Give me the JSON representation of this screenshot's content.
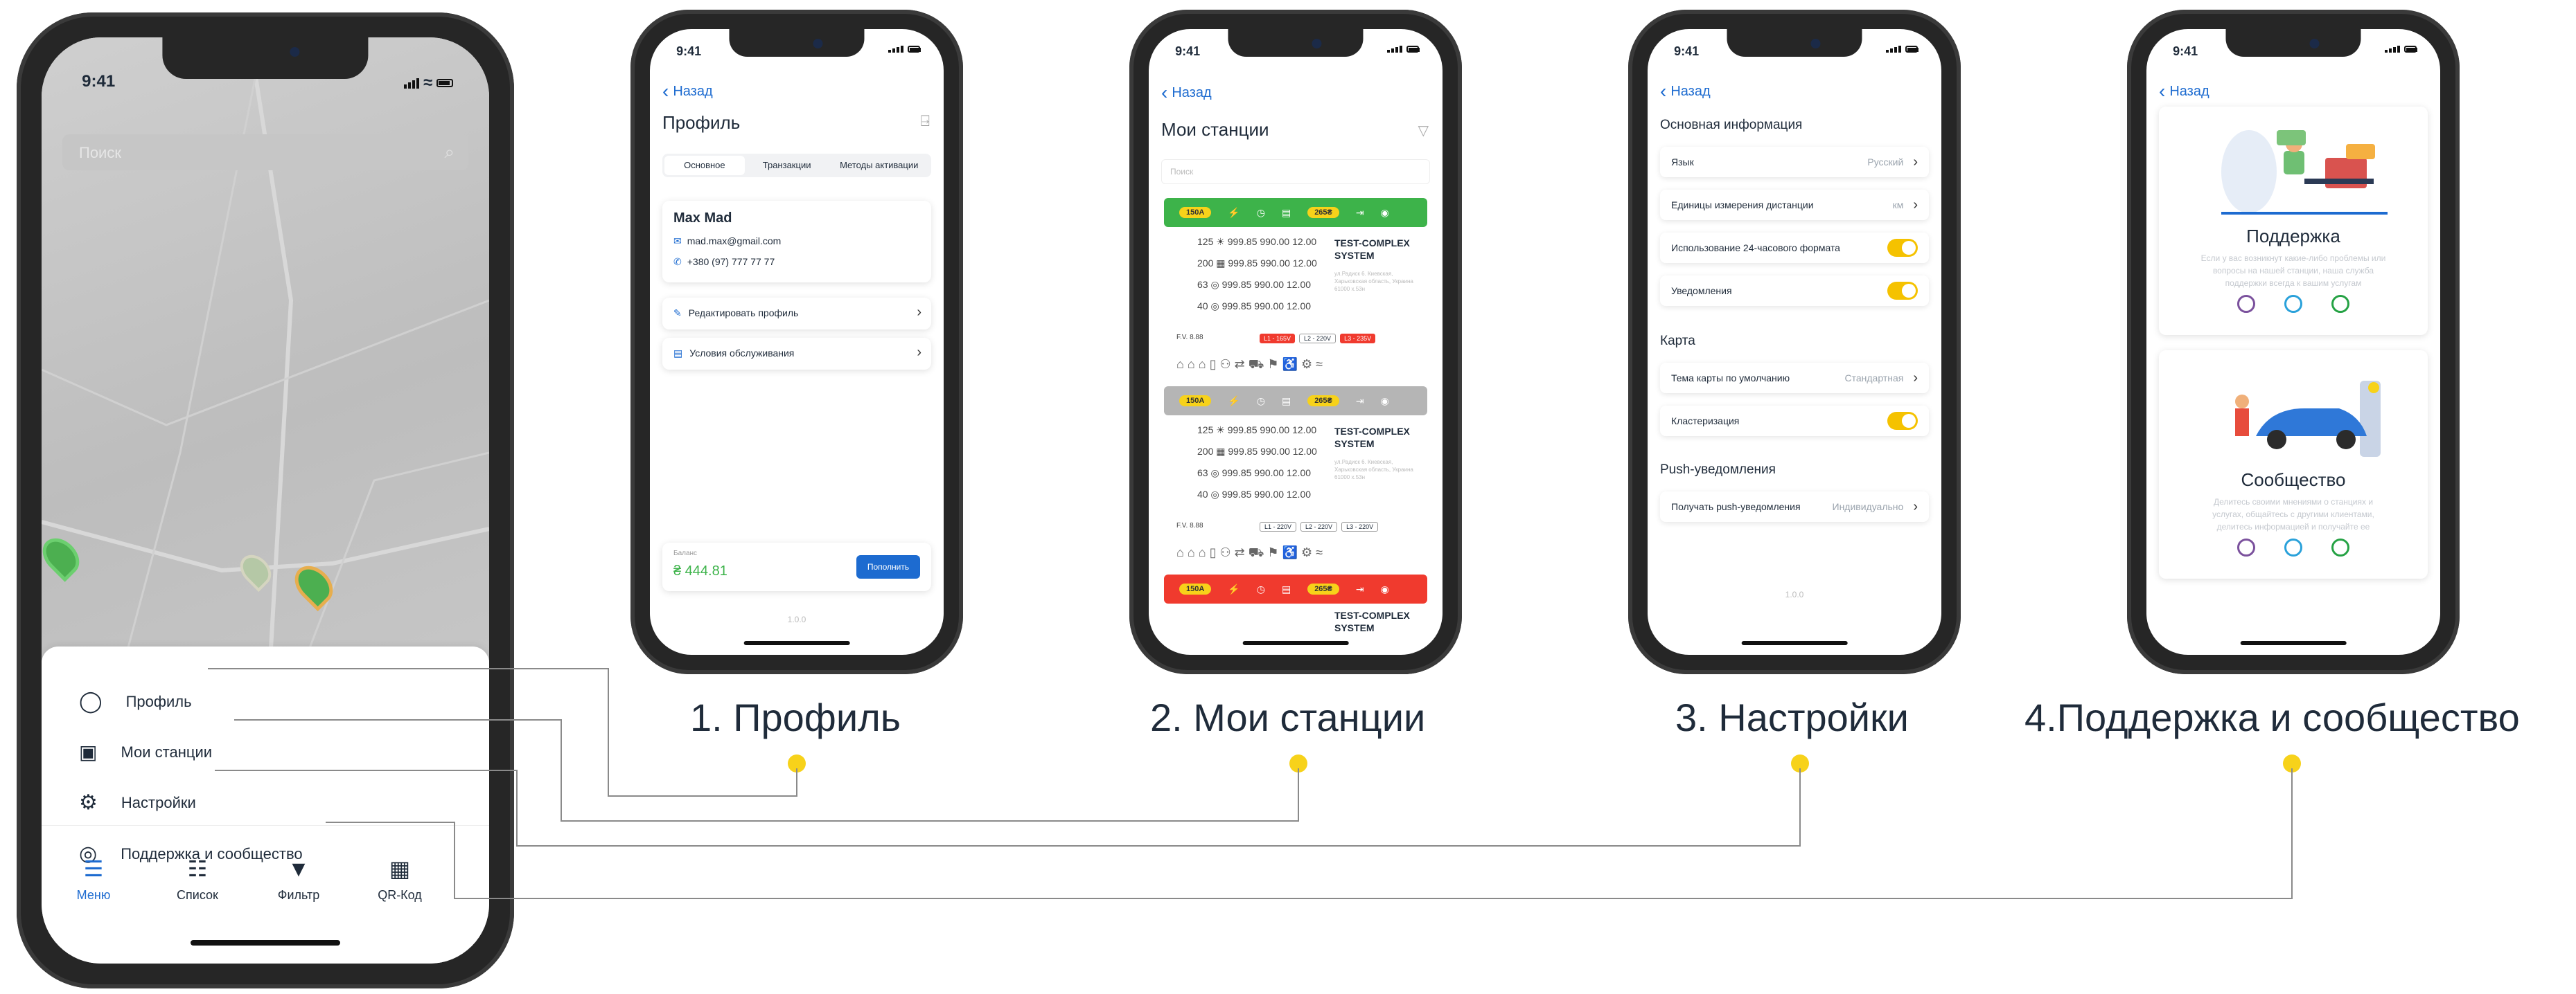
{
  "status": {
    "time": "9:41"
  },
  "colors": {
    "accent": "#1d6bd0",
    "yellow": "#f7d21a",
    "green": "#3db34a",
    "grey": "#a6a6a6",
    "red": "#f03a2e"
  },
  "main_screen": {
    "search_placeholder": "Поиск",
    "menu": [
      {
        "label": "Профиль",
        "icon": "user-icon"
      },
      {
        "label": "Мои станции",
        "icon": "charger-icon"
      },
      {
        "label": "Настройки",
        "icon": "gear-icon"
      },
      {
        "label": "Поддержка и сообщество",
        "icon": "support-icon"
      }
    ],
    "tabs": [
      {
        "label": "Меню",
        "icon": "menu-icon"
      },
      {
        "label": "Список",
        "icon": "list-icon"
      },
      {
        "label": "Фильтр",
        "icon": "filter-icon"
      },
      {
        "label": "QR-Код",
        "icon": "qr-icon"
      }
    ]
  },
  "profile": {
    "back": "Назад",
    "title": "Профиль",
    "tabs": [
      "Основное",
      "Транзакции",
      "Методы активации"
    ],
    "name": "Max Mad",
    "email": "mad.max@gmail.com",
    "phone": "+380 (97) 777 77 77",
    "edit": "Редактировать профиль",
    "terms": "Условия обслуживания",
    "balance_label": "Баланс",
    "balance": "₴ 444.81",
    "topup": "Пополнить",
    "version": "1.0.0"
  },
  "stations": {
    "back": "Назад",
    "title": "Мои станции",
    "search": "Поиск",
    "bars": [
      {
        "power": "150A",
        "price": "265₴"
      },
      {
        "power": "150A",
        "price": "265₴"
      },
      {
        "power": "150A",
        "price": "265₴"
      }
    ],
    "lines": [
      "125 ☀ 999.85 990.00 12.00",
      "200 ▦ 999.85 990.00 12.00",
      "63 ◎ 999.85 990.00 12.00",
      "40 ◎ 999.85 990.00 12.00"
    ],
    "name": "TEST-COMPLEX SYSTEM",
    "address": "ул.Радиск 6. Киевская, Харьковская область, Украина 61000 х.53н",
    "fv": "F.V. 8.88",
    "phases": [
      "L1 - 165V",
      "L2 - 220V",
      "L3 - 235V"
    ],
    "phases_ok": [
      "L1 - 220V",
      "L2 - 220V",
      "L3 - 220V"
    ]
  },
  "settings": {
    "back": "Назад",
    "section_main": "Основная информация",
    "language": "Язык",
    "language_val": "Русский",
    "units": "Единицы измерения дистанции",
    "units_val": "км",
    "h24": "Использование 24-часового формата",
    "notifications": "Уведомления",
    "section_map": "Карта",
    "map_theme": "Тема карты по умолчанию",
    "map_theme_val": "Стандартная",
    "clustering": "Кластеризация",
    "section_push": "Push-уведомления",
    "push": "Получать push-уведомления",
    "push_val": "Индивидуально",
    "version": "1.0.0"
  },
  "support": {
    "back": "Назад",
    "support_title": "Поддержка",
    "support_text": "Если у вас возникнут какие-либо проблемы или вопросы на нашей станции, наша служба поддержки всегда к вашим услугам",
    "community_title": "Сообщество",
    "community_text": "Делитесь своими мнениями о станциях и услугах, общайтесь с другими клиентами, делитесь информацией и получайте ее"
  },
  "captions": [
    "1. Профиль",
    "2. Мои станции",
    "3. Настройки",
    "4.Поддержка и сообщество"
  ]
}
